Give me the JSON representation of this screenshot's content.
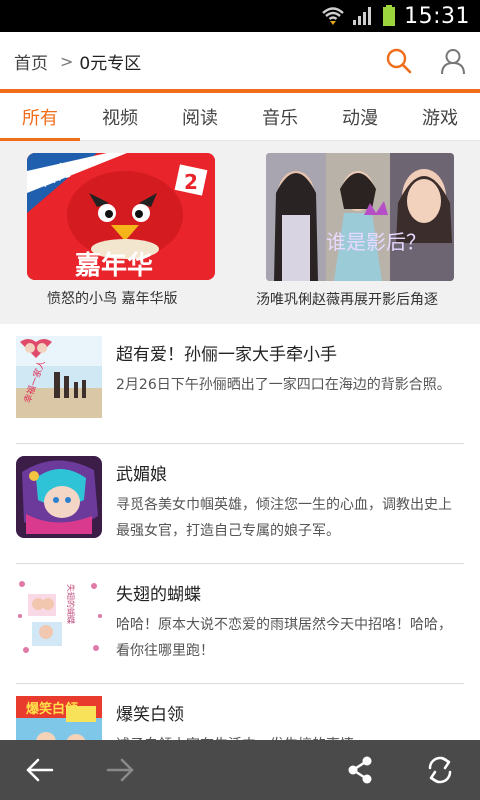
{
  "status_bar": {
    "time": "15:31"
  },
  "header": {
    "breadcrumb_home": "首页",
    "breadcrumb_sep": ">",
    "breadcrumb_current": "0元专区",
    "accent_color": "#f06d1b"
  },
  "tabs": [
    {
      "label": "所有",
      "active": true
    },
    {
      "label": "视频"
    },
    {
      "label": "阅读"
    },
    {
      "label": "音乐"
    },
    {
      "label": "动漫"
    },
    {
      "label": "游戏"
    }
  ],
  "featured": [
    {
      "caption": "愤怒的小鸟 嘉年华版",
      "image_text_top": "官方",
      "image_text_bottom": "嘉年华",
      "badge": "2"
    },
    {
      "caption": "汤唯巩俐赵薇再展开影后角逐",
      "image_text": "谁是影后？"
    }
  ],
  "list": [
    {
      "title": "超有爱！孙俪一家大手牵小手",
      "desc": "2月26日下午孙俪晒出了一家四口在海边的背影合照。",
      "thumb_text": "幸福一家人"
    },
    {
      "title": "武媚娘",
      "desc": "寻觅各美女巾帼英雄，倾注您一生的心血，调教出史上最强女官，打造自己专属的娘子军。"
    },
    {
      "title": "失翅的蝴蝶",
      "desc": "哈哈！原本大说不恋爱的雨琪居然今天中招咯！哈哈，看你往哪里跑！",
      "thumb_text": "失翅的蝴蝶"
    },
    {
      "title": "爆笑白领",
      "desc": "述子白领小宇在生活中，发生搞的事情",
      "thumb_text": "爆笑白领"
    }
  ],
  "icons": {
    "back": "back-arrow-icon",
    "forward": "forward-arrow-icon",
    "share": "share-icon",
    "refresh": "refresh-icon",
    "search": "search-icon",
    "user": "user-icon"
  }
}
